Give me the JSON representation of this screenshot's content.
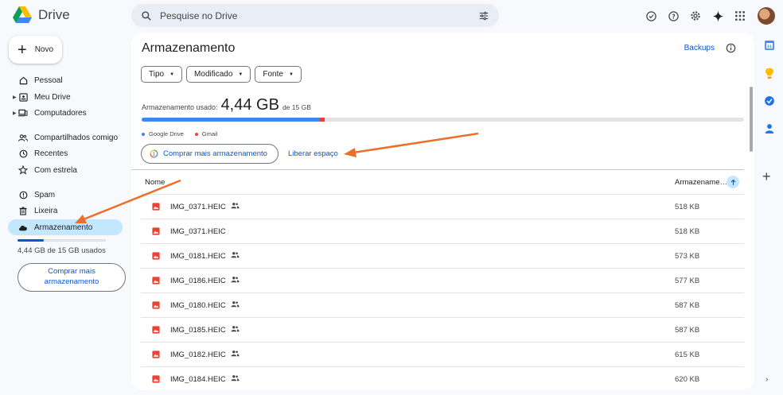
{
  "app": {
    "name": "Drive"
  },
  "search": {
    "placeholder": "Pesquise no Drive"
  },
  "sidebar": {
    "new_label": "Novo",
    "items": [
      {
        "label": "Pessoal",
        "icon": "home-icon"
      },
      {
        "label": "Meu Drive",
        "icon": "my-drive-icon"
      },
      {
        "label": "Computadores",
        "icon": "computer-icon"
      },
      {
        "label": "Compartilhados comigo",
        "icon": "people-icon"
      },
      {
        "label": "Recentes",
        "icon": "clock-icon"
      },
      {
        "label": "Com estrela",
        "icon": "star-icon"
      },
      {
        "label": "Spam",
        "icon": "spam-icon"
      },
      {
        "label": "Lixeira",
        "icon": "trash-icon"
      },
      {
        "label": "Armazenamento",
        "icon": "cloud-icon"
      }
    ],
    "usage_text": "4,44 GB de 15 GB usados",
    "usage_fraction": 0.3,
    "buy_label_line1": "Comprar mais",
    "buy_label_line2": "armazenamento"
  },
  "main": {
    "title": "Armazenamento",
    "backups_label": "Backups",
    "filters": [
      "Tipo",
      "Modificado",
      "Fonte"
    ],
    "used_label": "Armazenamento usado:",
    "used_value": "4,44 GB",
    "used_total": "de 15 GB",
    "drive_fraction": 0.296,
    "gmail_fraction": 0.008,
    "legend": [
      {
        "label": "Google Drive",
        "color": "#4285f4"
      },
      {
        "label": "Gmail",
        "color": "#ea4335"
      }
    ],
    "buy_label": "Comprar mais armazenamento",
    "free_label": "Liberar espaço",
    "col_name": "Nome",
    "col_size": "Armazename…",
    "files": [
      {
        "name": "IMG_0371.HEIC",
        "shared": true,
        "size": "518 KB"
      },
      {
        "name": "IMG_0371.HEIC",
        "shared": false,
        "size": "518 KB"
      },
      {
        "name": "IMG_0181.HEIC",
        "shared": true,
        "size": "573 KB"
      },
      {
        "name": "IMG_0186.HEIC",
        "shared": true,
        "size": "577 KB"
      },
      {
        "name": "IMG_0180.HEIC",
        "shared": true,
        "size": "587 KB"
      },
      {
        "name": "IMG_0185.HEIC",
        "shared": true,
        "size": "587 KB"
      },
      {
        "name": "IMG_0182.HEIC",
        "shared": true,
        "size": "615 KB"
      },
      {
        "name": "IMG_0184.HEIC",
        "shared": true,
        "size": "620 KB"
      }
    ]
  },
  "colors": {
    "accent": "#0b57d0",
    "active_bg": "#c2e7ff",
    "annotation": "#e8702a"
  }
}
